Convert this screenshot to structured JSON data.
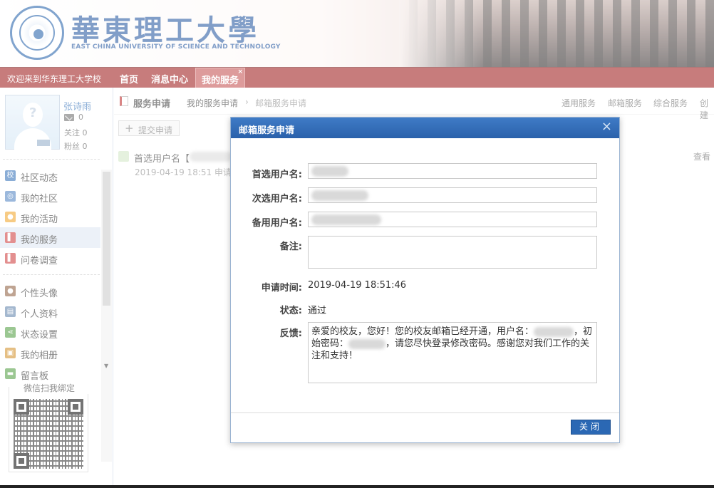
{
  "banner": {
    "name_cn": "華東理工大學",
    "name_en": "EAST CHINA UNIVERSITY OF SCIENCE AND TECHNOLOGY"
  },
  "nav": {
    "welcome": "欢迎来到华东理工大学校",
    "items": [
      "首页",
      "消息中心"
    ],
    "active": "我的服务",
    "active_close": "×"
  },
  "user": {
    "name": "张诗雨",
    "messages": "0",
    "follow": "关注 0",
    "fans": "粉丝 0"
  },
  "sidebar": {
    "group1": [
      {
        "label": "社区动态",
        "icon": "school-icon",
        "color": "#2a6bb5",
        "glyph": "校"
      },
      {
        "label": "我的社区",
        "icon": "community-icon",
        "color": "#4a7fc0",
        "glyph": "◎"
      },
      {
        "label": "我的活动",
        "icon": "activity-icon",
        "color": "#f0a020",
        "glyph": "●"
      },
      {
        "label": "我的服务",
        "icon": "service-icon",
        "color": "#c33",
        "glyph": "▌"
      },
      {
        "label": "问卷调查",
        "icon": "survey-icon",
        "color": "#c33",
        "glyph": "▌"
      }
    ],
    "group2": [
      {
        "label": "个性头像",
        "icon": "avatar-icon",
        "color": "#8a5a3a",
        "glyph": "●"
      },
      {
        "label": "个人资料",
        "icon": "profile-icon",
        "color": "#5a7ea8",
        "glyph": "▤"
      },
      {
        "label": "状态设置",
        "icon": "share-icon",
        "color": "#4a9a3a",
        "glyph": "⋖"
      },
      {
        "label": "我的相册",
        "icon": "album-icon",
        "color": "#d08a20",
        "glyph": "▣"
      },
      {
        "label": "留言板",
        "icon": "message-board-icon",
        "color": "#4a9a3a",
        "glyph": "▬"
      }
    ],
    "qr_title": "微信扫我绑定"
  },
  "main": {
    "title": "服务申请",
    "crumb1": "我的服务申请",
    "crumb_sep": "›",
    "crumb2": "邮箱服务申请",
    "links": [
      "通用服务",
      "邮箱服务",
      "综合服务",
      "创建"
    ],
    "submit": "提交申请",
    "record_title": "首选用户名【",
    "record_time": "2019-04-19 18:51 申请",
    "record_view": "查看"
  },
  "dialog": {
    "title": "邮箱服务申请",
    "close_icon": "×",
    "label_pref": "首选用户名:",
    "label_second": "次选用户名:",
    "label_backup": "备用用户名:",
    "label_note": "备注:",
    "label_time": "申请时间:",
    "time_value": "2019-04-19 18:51:46",
    "label_status": "状态:",
    "status_value": "通过",
    "label_feedback": "反馈:",
    "feedback_a": "亲爱的校友，您好！您的校友邮箱已经开通，用户名：",
    "feedback_b": "，初始密码：",
    "feedback_c": "，请您尽快登录修改密码。感谢您对我们工作的关注和支持！",
    "close_button": "关闭"
  },
  "colors": {
    "nav_bg": "#9a1111",
    "dialog_header": "#2a61ab",
    "link_blue": "#2a6bb5"
  }
}
